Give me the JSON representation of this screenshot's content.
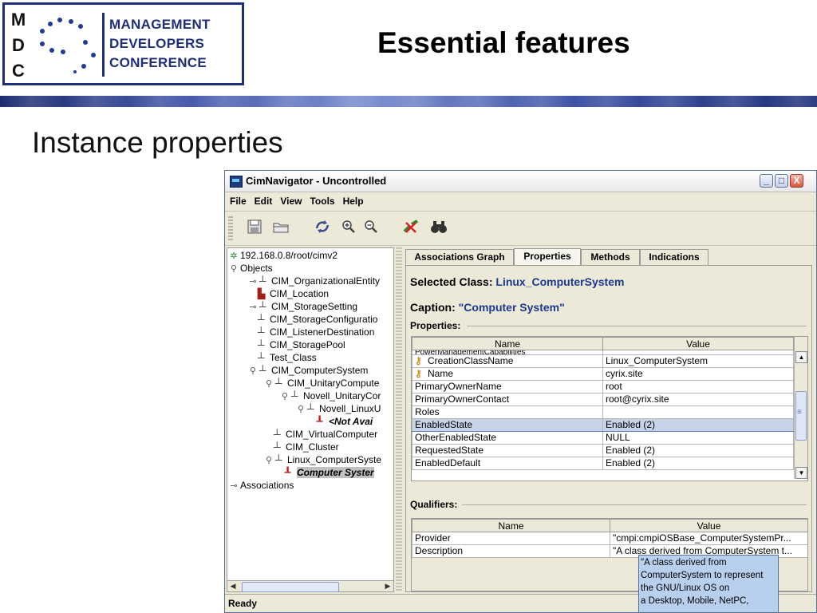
{
  "slide": {
    "logo": {
      "letters": [
        "M",
        "D",
        "C"
      ],
      "lines": [
        "MANAGEMENT",
        "DEVELOPERS",
        "CONFERENCE"
      ]
    },
    "title": "Essential features",
    "subtitle": "Instance properties"
  },
  "window": {
    "title": "CimNavigator - Uncontrolled",
    "controls": {
      "minimize": "_",
      "maximize": "□",
      "close": "X"
    },
    "menu": [
      "File",
      "Edit",
      "View",
      "Tools",
      "Help"
    ],
    "toolbar_icons": [
      "save-icon",
      "open-folder-icon",
      "refresh-icon",
      "zoom-in-icon",
      "zoom-out-icon",
      "disconnect-icon",
      "binoculars-icon"
    ],
    "status": "Ready"
  },
  "tree": {
    "root": "192.168.0.8/root/cimv2",
    "nodes": [
      "Objects",
      "CIM_OrganizationalEntity",
      "CIM_Location",
      "CIM_StorageSetting",
      "CIM_StorageConfiguratio",
      "CIM_ListenerDestination",
      "CIM_StoragePool",
      "Test_Class",
      "CIM_ComputerSystem",
      "CIM_UnitaryCompute",
      "Novell_UnitaryCor",
      "Novell_LinuxU",
      "<Not Avai",
      "CIM_VirtualComputer",
      "CIM_Cluster",
      "Linux_ComputerSyste",
      "Computer Syster",
      "Associations"
    ]
  },
  "tabs": [
    "Associations Graph",
    "Properties",
    "Methods",
    "Indications"
  ],
  "active_tab": "Properties",
  "selected_class": {
    "label": "Selected Class:",
    "value": "Linux_ComputerSystem"
  },
  "caption": {
    "label": "Caption:",
    "value": "\"Computer System\""
  },
  "properties": {
    "label": "Properties:",
    "columns": [
      "Name",
      "Value"
    ],
    "partial_top": "PowerManagementCapabilities",
    "rows": [
      {
        "name": "CreationClassName",
        "value": "Linux_ComputerSystem",
        "key": true
      },
      {
        "name": "Name",
        "value": "cyrix.site",
        "key": true
      },
      {
        "name": "PrimaryOwnerName",
        "value": "root",
        "key": false
      },
      {
        "name": "PrimaryOwnerContact",
        "value": "root@cyrix.site",
        "key": false
      },
      {
        "name": "Roles",
        "value": "",
        "key": false
      },
      {
        "name": "EnabledState",
        "value": "Enabled (2)",
        "key": false,
        "selected": true
      },
      {
        "name": "OtherEnabledState",
        "value": "NULL",
        "key": false
      },
      {
        "name": "RequestedState",
        "value": "Enabled (2)",
        "key": false
      },
      {
        "name": "EnabledDefault",
        "value": "Enabled (2)",
        "key": false
      }
    ]
  },
  "qualifiers": {
    "label": "Qualifiers:",
    "columns": [
      "Name",
      "Value"
    ],
    "rows": [
      {
        "name": "Provider",
        "value": "\"cmpi:cmpiOSBase_ComputerSystemPr..."
      },
      {
        "name": "Description",
        "value": "\"A class derived from ComputerSystem t..."
      }
    ]
  },
  "tooltip": {
    "lines": [
      "\"A class derived from",
      "ComputerSystem to represent",
      "the GNU/Linux OS on",
      "a Desktop, Mobile, NetPC,"
    ]
  }
}
